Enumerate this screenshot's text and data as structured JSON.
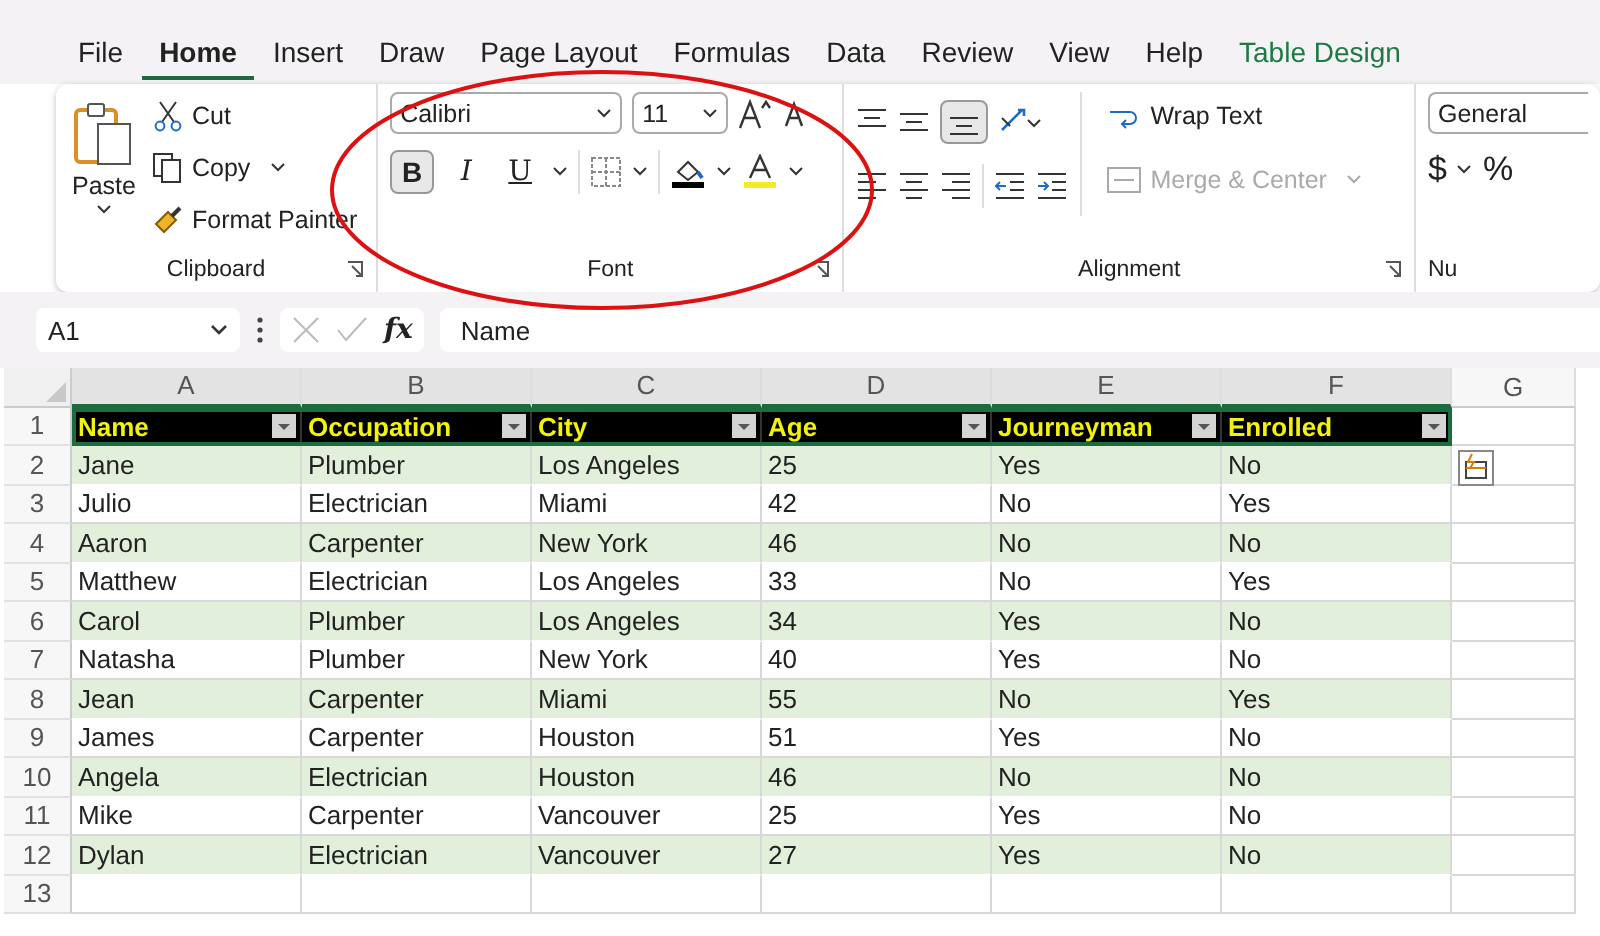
{
  "tabs": [
    {
      "label": "File",
      "selected": false,
      "kind": "normal"
    },
    {
      "label": "Home",
      "selected": true,
      "kind": "normal"
    },
    {
      "label": "Insert",
      "selected": false,
      "kind": "normal"
    },
    {
      "label": "Draw",
      "selected": false,
      "kind": "normal"
    },
    {
      "label": "Page Layout",
      "selected": false,
      "kind": "normal"
    },
    {
      "label": "Formulas",
      "selected": false,
      "kind": "normal"
    },
    {
      "label": "Data",
      "selected": false,
      "kind": "normal"
    },
    {
      "label": "Review",
      "selected": false,
      "kind": "normal"
    },
    {
      "label": "View",
      "selected": false,
      "kind": "normal"
    },
    {
      "label": "Help",
      "selected": false,
      "kind": "normal"
    },
    {
      "label": "Table Design",
      "selected": false,
      "kind": "contextual"
    }
  ],
  "ribbon": {
    "clipboard": {
      "title": "Clipboard",
      "paste": "Paste",
      "cut": "Cut",
      "copy": "Copy",
      "format_painter": "Format Painter"
    },
    "font": {
      "title": "Font",
      "font_name": "Calibri",
      "font_size": "11",
      "bold": {
        "label": "B",
        "selected": true
      },
      "italic": {
        "label": "I",
        "selected": false
      },
      "underline": {
        "label": "U",
        "selected": false
      }
    },
    "alignment": {
      "title": "Alignment",
      "bottom_align_selected": true,
      "wrap_text": "Wrap Text",
      "merge_center": {
        "label": "Merge & Center",
        "disabled": true
      }
    },
    "number": {
      "title": "Nu",
      "format": "General",
      "currency": "$",
      "percent": "%"
    }
  },
  "formula_bar": {
    "cell_ref": "A1",
    "fx": "fx",
    "value": "Name"
  },
  "sheet": {
    "column_letters": [
      {
        "label": "A",
        "selected": true
      },
      {
        "label": "B",
        "selected": true
      },
      {
        "label": "C",
        "selected": true
      },
      {
        "label": "D",
        "selected": true
      },
      {
        "label": "E",
        "selected": true
      },
      {
        "label": "F",
        "selected": true
      },
      {
        "label": "G",
        "selected": false
      }
    ],
    "row_numbers": [
      "1",
      "2",
      "3",
      "4",
      "5",
      "6",
      "7",
      "8",
      "9",
      "10",
      "11",
      "12",
      "13"
    ],
    "table": {
      "columns": [
        "Name",
        "Occupation",
        "City",
        "Age",
        "Journeyman",
        "Enrolled"
      ],
      "rows": [
        [
          "Jane",
          "Plumber",
          "Los Angeles",
          "25",
          "Yes",
          "No"
        ],
        [
          "Julio",
          "Electrician",
          "Miami",
          "42",
          "No",
          "Yes"
        ],
        [
          "Aaron",
          "Carpenter",
          "New York",
          "46",
          "No",
          "No"
        ],
        [
          "Matthew",
          "Electrician",
          "Los Angeles",
          "33",
          "No",
          "Yes"
        ],
        [
          "Carol",
          "Plumber",
          "Los Angeles",
          "34",
          "Yes",
          "No"
        ],
        [
          "Natasha",
          "Plumber",
          "New York",
          "40",
          "Yes",
          "No"
        ],
        [
          "Jean",
          "Carpenter",
          "Miami",
          "55",
          "No",
          "Yes"
        ],
        [
          "James",
          "Carpenter",
          "Houston",
          "51",
          "Yes",
          "No"
        ],
        [
          "Angela",
          "Electrician",
          "Houston",
          "46",
          "No",
          "No"
        ],
        [
          "Mike",
          "Carpenter",
          "Vancouver",
          "25",
          "Yes",
          "No"
        ],
        [
          "Dylan",
          "Electrician",
          "Vancouver",
          "27",
          "Yes",
          "No"
        ]
      ]
    }
  }
}
